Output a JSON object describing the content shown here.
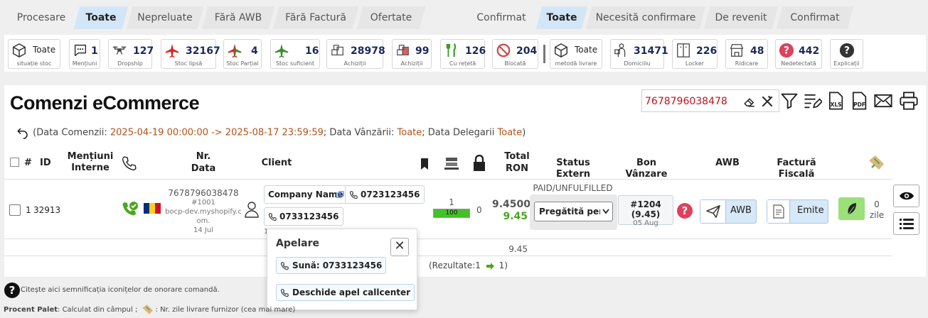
{
  "tabs_left": {
    "group_label": "Procesare",
    "items": [
      "Toate",
      "Nepreluate",
      "Fără AWB",
      "Fără Factură",
      "Ofertate"
    ]
  },
  "tabs_right": {
    "group_label": "Confirmat",
    "items": [
      "Toate",
      "Necesită confirmare",
      "De revenit",
      "Confirmat"
    ]
  },
  "stats": [
    {
      "value": "Toate",
      "label": "situație stoc",
      "icon": "box-icon"
    },
    {
      "value": "1",
      "label": "Mențiuni",
      "icon": "speech-bubble-icon"
    },
    {
      "value": "127",
      "label": "Dropship",
      "icon": "drone-icon"
    },
    {
      "value": "32167",
      "label": "Stoc lipsă",
      "icon": "red-plane-icon"
    },
    {
      "value": "4",
      "label": "Stoc Parțial",
      "icon": "red-green-plane-icon"
    },
    {
      "value": "16",
      "label": "Stoc suficient",
      "icon": "green-plane-icon"
    },
    {
      "value": "28978",
      "label": "Achiziții",
      "icon": "boxes-icon"
    },
    {
      "value": "99",
      "label": "Achiziții",
      "icon": "red-boxes-icon"
    },
    {
      "value": "126",
      "label": "Cu rețetă",
      "icon": "fork-knife-icon"
    },
    {
      "value": "204",
      "label": "Blocată",
      "icon": "prohibited-icon"
    },
    {
      "value": "Toate",
      "label": "metodă livrare",
      "icon": "box-icon"
    },
    {
      "value": "31471",
      "label": "Domiciliu",
      "icon": "courier-icon"
    },
    {
      "value": "226",
      "label": "Locker",
      "icon": "locker-icon"
    },
    {
      "value": "48",
      "label": "Ridicare",
      "icon": "store-icon"
    },
    {
      "value": "442",
      "label": "Nedetectată",
      "icon": "question-red-icon"
    },
    {
      "value": "",
      "label": "Explicații",
      "icon": "question-dark-icon"
    }
  ],
  "page": {
    "title": "Comenzi eCommerce",
    "search_value": "7678796038478",
    "filters": {
      "prefix": "(Data Comenzii: ",
      "date_range": "2025-04-19 00:00:00 -> 2025-08-17 23:59:59",
      "sales_label": "; Data Vânzării: ",
      "sales_value": "Toate",
      "deleg_label": "; Data Delegarii ",
      "deleg_value": "Toate",
      "suffix": ")"
    }
  },
  "table": {
    "headers": {
      "hash": "#",
      "id": "ID",
      "mentions": "Mențiuni Interne",
      "nr": "Nr.",
      "data": "Data",
      "client": "Client",
      "total": "Total",
      "currency": "RON",
      "status_ext": "Status Extern",
      "bon": "Bon Vânzare",
      "awb": "AWB",
      "invoice": "Factură Fiscală"
    },
    "row": {
      "index": "1",
      "id": "32913",
      "order_nr": "7678796038478",
      "order_ref": "#1001",
      "shop": "bocp-dev.myshopify.c om.",
      "date": "14 Jul",
      "company": "Company Name",
      "phone1": "0723123456",
      "phone2": "0733123456",
      "row_hint": "1",
      "qty": "1",
      "qty_bar": "100",
      "qty_pct": 100,
      "locked": "0",
      "total": "9.4500",
      "total_paid": "9.45",
      "ext_status": "PAID/UNFULFILLED",
      "status_select": "Pregătită pentru livrare",
      "bon": "#1204 (9.45)",
      "bon_date": "05 Aug",
      "awb_btn": "AWB",
      "invoice_btn": "Emite",
      "days": "0",
      "days_label": "zile"
    },
    "sum_total": "9.45",
    "results_prefix": "(Rezultate:",
    "results_count": "1",
    "results_pages": "1)"
  },
  "popup": {
    "title": "Apelare",
    "call_btn": "Sună: 0733123456",
    "callcenter_btn": "Deschide apel callcenter"
  },
  "footer": {
    "line1": "Citește aici semnificația iconițelor de onorare comandă.",
    "line2_bold": "Procent Palet",
    "line2_a": ": Calculat din câmpul ;",
    "line2_b": ": Nr. zile livrare furnizor (cea mai mare)"
  },
  "colors": {
    "accent_tab": "#d3e6f7",
    "search_text": "#c0111f",
    "filter_highlight": "#b0531a",
    "paid_green": "#4aa71e",
    "bar_green": "#44c02a"
  }
}
